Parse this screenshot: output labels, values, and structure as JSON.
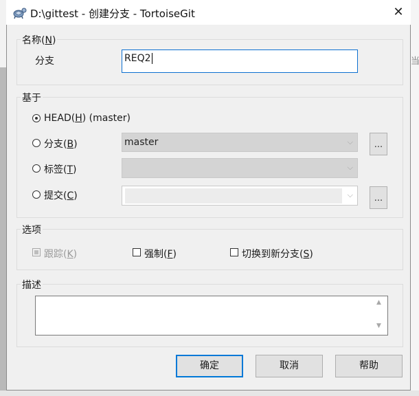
{
  "window": {
    "title": "D:\\gittest - 创建分支 - TortoiseGit",
    "close_glyph": "✕"
  },
  "background": {
    "right_char": "当"
  },
  "name_group": {
    "label": "名称",
    "hotkey": "N",
    "field_label": "分支",
    "field_value": "REQ2"
  },
  "base_group": {
    "label": "基于",
    "options": [
      {
        "label": "HEAD",
        "hotkey": "H",
        "suffix": " (master)",
        "selected": true
      },
      {
        "label": "分支",
        "hotkey": "B",
        "selected": false
      },
      {
        "label": "标签",
        "hotkey": "T",
        "selected": false
      },
      {
        "label": "提交",
        "hotkey": "C",
        "selected": false
      }
    ],
    "branch_combo_value": "master",
    "tag_combo_value": "",
    "commit_combo_value": "",
    "browse_label": "..."
  },
  "options_group": {
    "label": "选项",
    "track": {
      "label": "跟踪",
      "hotkey": "K",
      "checked": true,
      "enabled": false
    },
    "force": {
      "label": "强制",
      "hotkey": "F",
      "checked": false
    },
    "switch": {
      "label": "切换到新分支",
      "hotkey": "S",
      "checked": false
    }
  },
  "desc_group": {
    "label": "描述",
    "value": ""
  },
  "buttons": {
    "ok": "确定",
    "cancel": "取消",
    "help": "帮助"
  },
  "icons": {
    "app": "tortoisegit-icon",
    "up": "▲",
    "down": "▼",
    "combo": "⌵"
  }
}
